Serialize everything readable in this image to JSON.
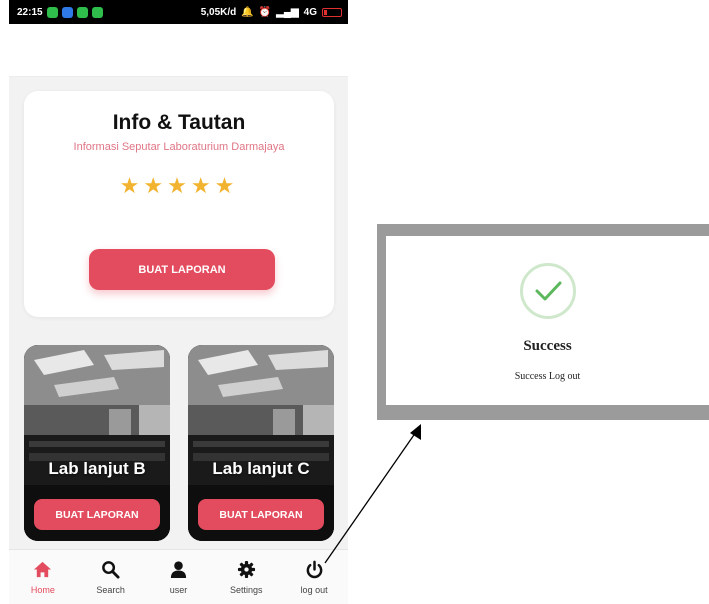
{
  "statusbar": {
    "time": "22:15",
    "network": "5,05K/d",
    "battery_level": "4G"
  },
  "info_card": {
    "title": "Info & Tautan",
    "subtitle": "Informasi Seputar Laboraturium Darmajaya",
    "rating": 5,
    "button_label": "BUAT LAPORAN"
  },
  "labs": [
    {
      "name": "Lab lanjut B",
      "button_label": "BUAT LAPORAN"
    },
    {
      "name": "Lab lanjut C",
      "button_label": "BUAT LAPORAN"
    }
  ],
  "nav": {
    "home": "Home",
    "search": "Search",
    "user": "user",
    "settings": "Settings",
    "logout": "log out"
  },
  "dialog": {
    "title": "Success",
    "message": "Success Log out"
  },
  "colors": {
    "accent": "#e34c5e",
    "star": "#f2b430",
    "success": "#5cb85c"
  }
}
